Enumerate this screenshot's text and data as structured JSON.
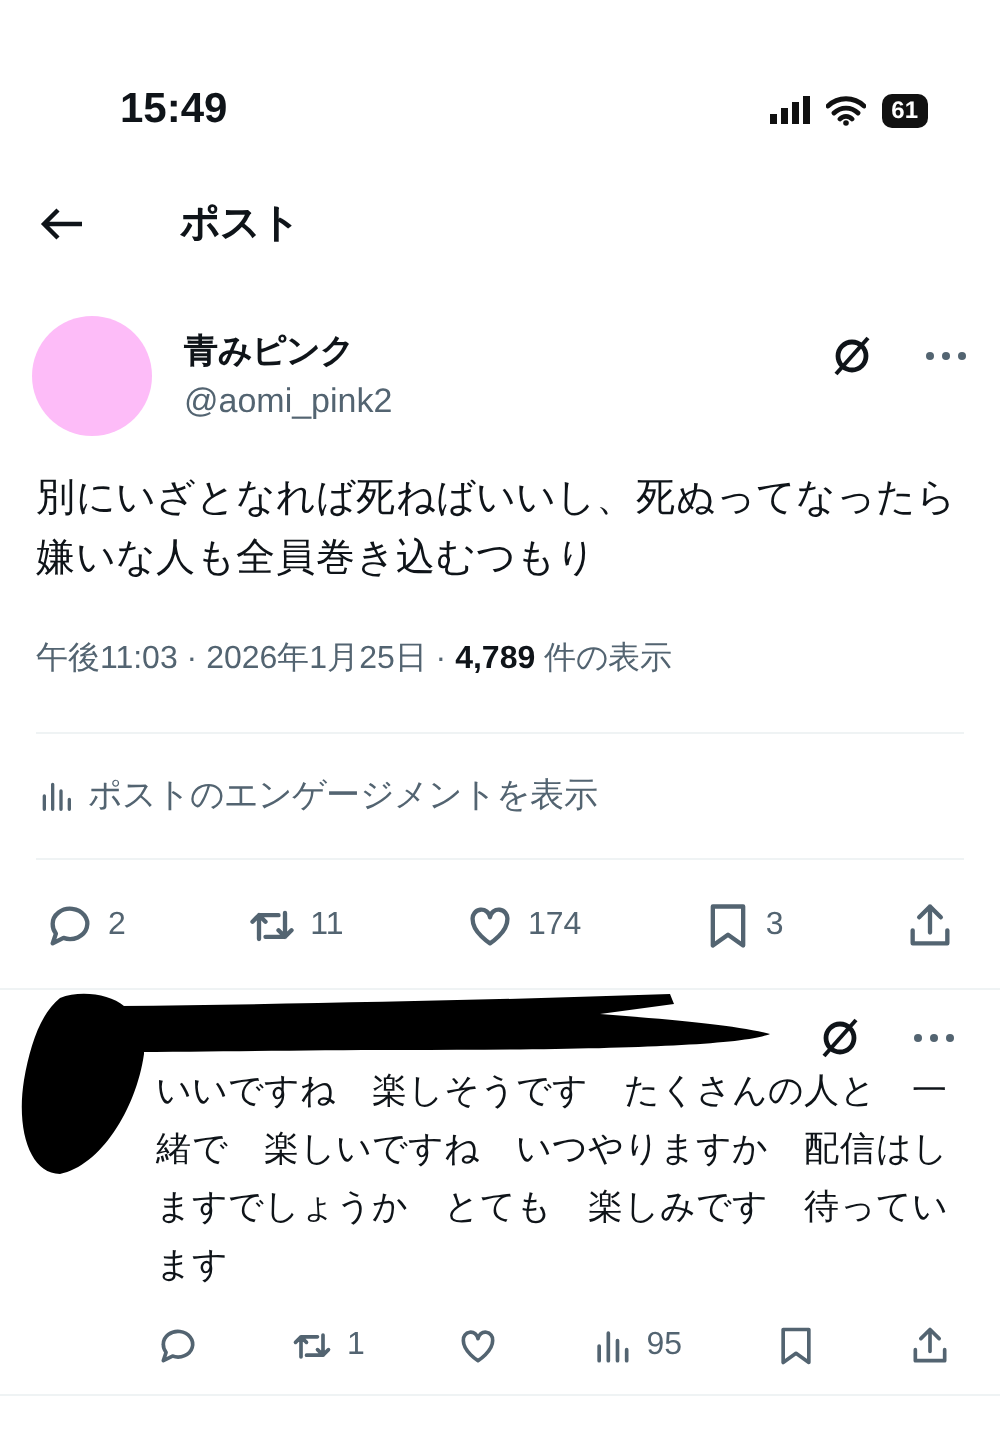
{
  "status_bar": {
    "time": "15:49",
    "battery": "61"
  },
  "header": {
    "title": "ポスト"
  },
  "post": {
    "display_name": "青みピンク",
    "handle": "@aomi_pink2",
    "text": "別にいざとなれば死ねばいいし、死ぬってなったら嫌いな人も全員巻き込むつもり",
    "time": "午後11:03 · 2026年1月25日 · ",
    "views": "4,789",
    "views_label": " 件の表示",
    "engagement": "ポストのエンゲージメントを表示",
    "actions": [
      {
        "kind": "reply",
        "count": "2"
      },
      {
        "kind": "repost",
        "count": "11"
      },
      {
        "kind": "like",
        "count": "174"
      },
      {
        "kind": "bookmark",
        "count": "3"
      },
      {
        "kind": "share"
      }
    ]
  },
  "reply": {
    "text": "いいですね　楽しそうです　たくさんの人と　一緒で　楽しいですね　いつやりますか　配信はしますでしょうか　とても　楽しみです　待っています",
    "actions": [
      {
        "kind": "reply"
      },
      {
        "kind": "repost",
        "count": "1"
      },
      {
        "kind": "like"
      },
      {
        "kind": "views",
        "count": "95"
      },
      {
        "kind": "bookmark"
      },
      {
        "kind": "share"
      }
    ]
  }
}
